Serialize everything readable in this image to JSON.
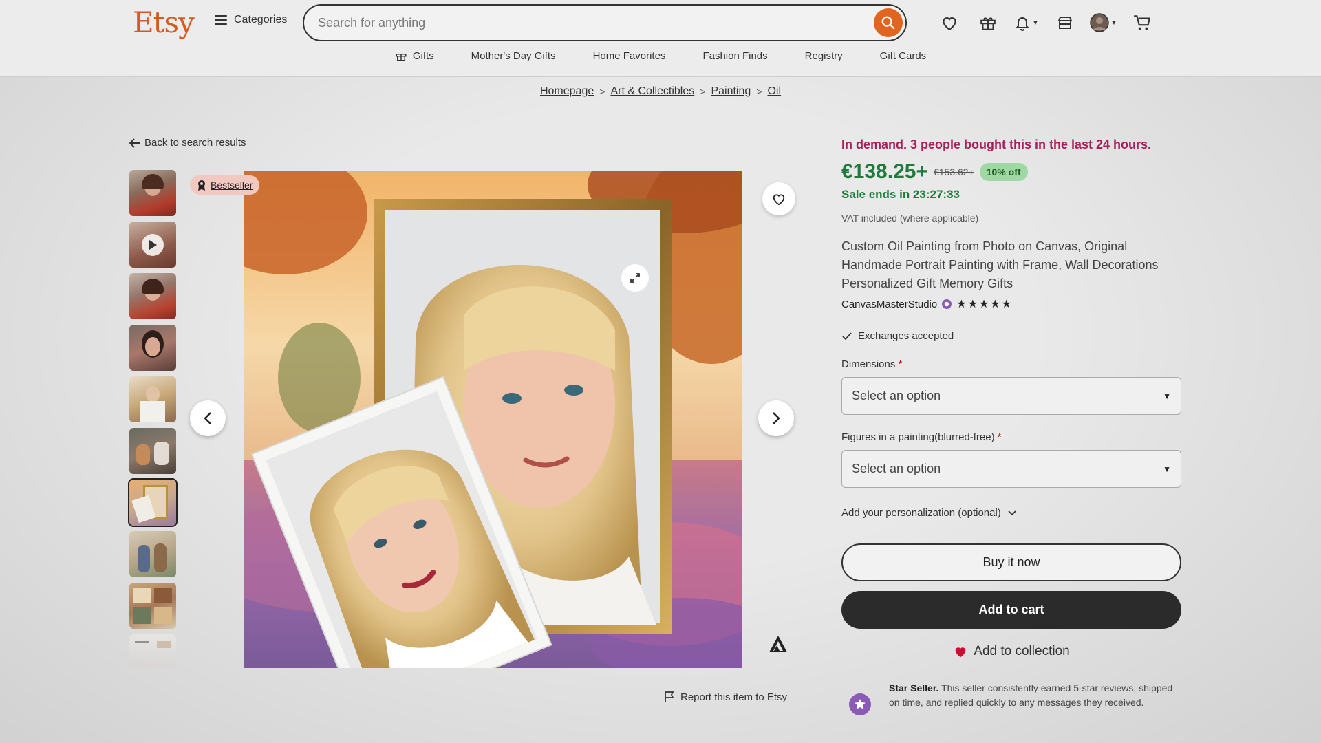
{
  "header": {
    "logo": "Etsy",
    "categories_label": "Categories",
    "search_placeholder": "Search for anything"
  },
  "nav": {
    "items": [
      "Gifts",
      "Mother's Day Gifts",
      "Home Favorites",
      "Fashion Finds",
      "Registry",
      "Gift Cards"
    ]
  },
  "breadcrumb": {
    "items": [
      "Homepage",
      "Art & Collectibles",
      "Painting",
      "Oil"
    ],
    "separator": ">"
  },
  "back_label": "Back to search results",
  "badge": {
    "label": "Bestseller"
  },
  "product": {
    "demand": "In demand. 3 people bought this in the last 24 hours.",
    "price": "€138.25+",
    "old_price": "€153.62+",
    "discount": "10% off",
    "sale_ends": "Sale ends in 23:27:33",
    "vat": "VAT included (where applicable)",
    "title": "Custom Oil Painting from Photo on Canvas, Original Handmade Portrait Painting with Frame, Wall Decorations Personalized Gift Memory Gifts",
    "shop_name": "CanvasMasterStudio",
    "rating_stars": 5,
    "stars_text": "★★★★★",
    "exchanges": "Exchanges accepted"
  },
  "options": {
    "dimensions_label": "Dimensions",
    "dimensions_value": "Select an option",
    "figures_label": "Figures in a painting(blurred-free)",
    "figures_value": "Select an option",
    "required_mark": "*",
    "personalization_label": "Add your personalization (optional)"
  },
  "actions": {
    "buy_now": "Buy it now",
    "add_to_cart": "Add to cart",
    "add_to_collection": "Add to collection",
    "report": "Report this item to Etsy"
  },
  "star_seller": {
    "title": "Star Seller.",
    "text": "This seller consistently earned 5-star reviews, shipped on time, and replied quickly to any messages they received."
  },
  "colors": {
    "brand": "#d65a1f",
    "search_button": "#e2651f",
    "demand": "#a6205a",
    "price": "#1e7b3c",
    "discount_bg": "#9fd8a5",
    "cart_button": "#2b2b2b",
    "heart": "#c8102e",
    "star_seller": "#8a5bb5"
  },
  "icons": {
    "search": "search-icon",
    "favorites": "heart-icon",
    "gift": "gift-icon",
    "notifications": "bell-icon",
    "shop": "shop-icon",
    "account": "avatar",
    "cart": "cart-icon"
  }
}
